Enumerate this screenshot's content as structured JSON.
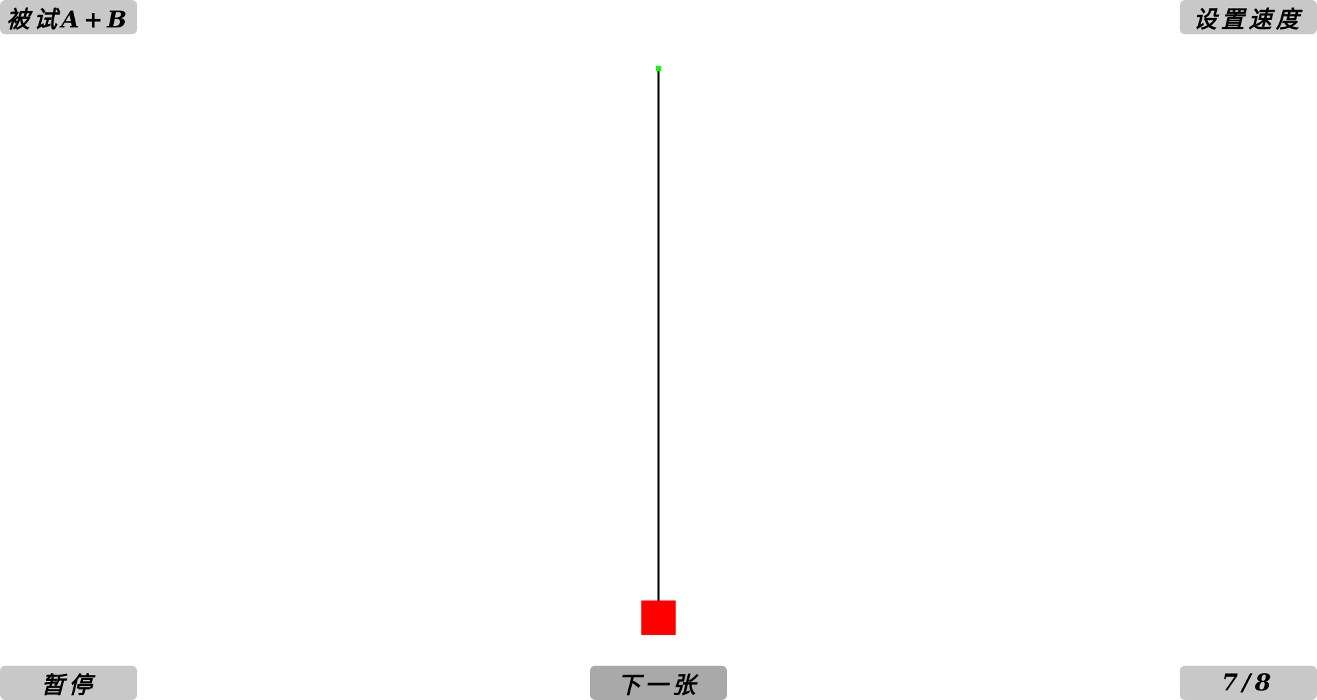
{
  "buttons": {
    "subject": "被试A+B",
    "set_speed": "设置速度",
    "pause": "暂停",
    "next": "下一张",
    "page_indicator": "7/8"
  },
  "pendulum": {
    "pivot_color": "#00ff00",
    "rod_color": "#000000",
    "bob_color": "#ff0000"
  }
}
